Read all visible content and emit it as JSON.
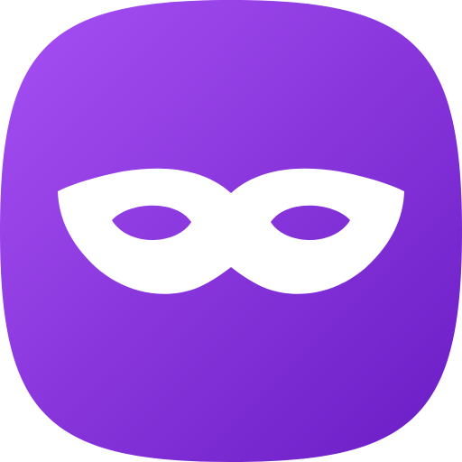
{
  "icon": {
    "name": "mask-icon",
    "gradient_start": "#A650F4",
    "gradient_end": "#6A1CC4",
    "glyph_color": "#FFFFFF"
  }
}
